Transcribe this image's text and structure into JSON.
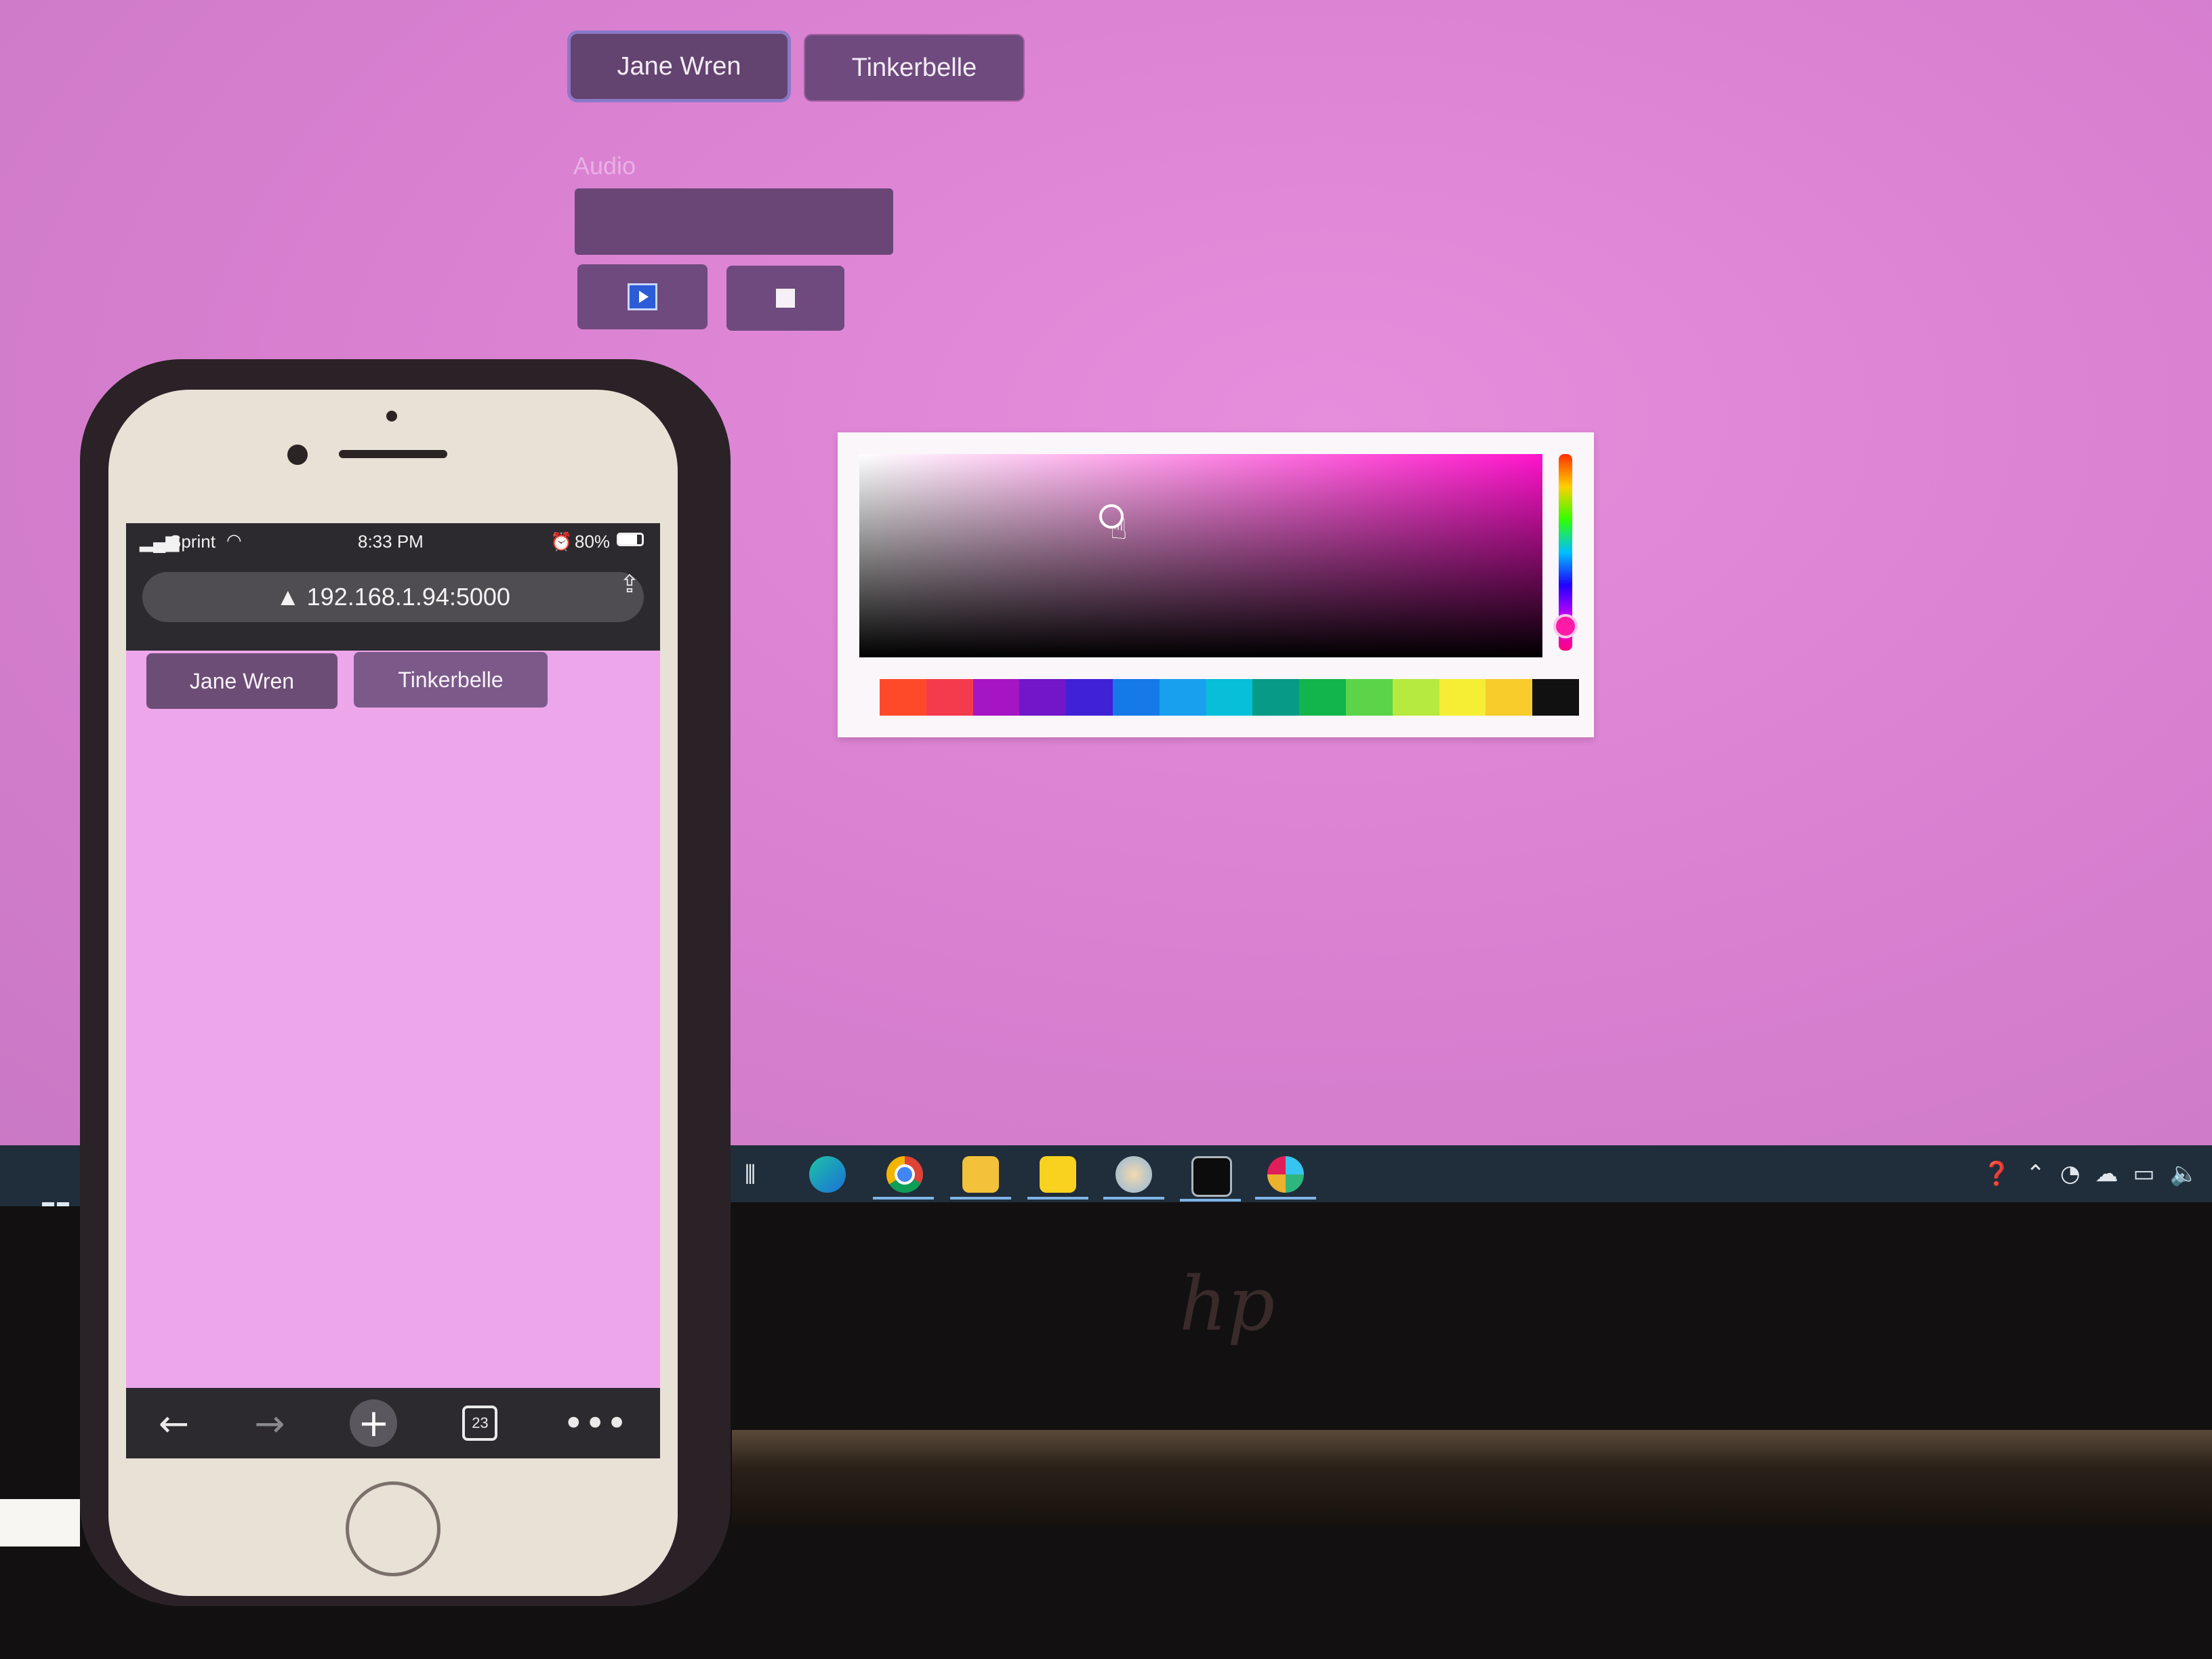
{
  "desktop": {
    "users": [
      {
        "label": "Jane Wren"
      },
      {
        "label": "Tinkerbelle"
      }
    ],
    "audio": {
      "label": "Audio",
      "value": ""
    },
    "media": {
      "play_icon": "play-icon",
      "stop_icon": "stop-icon"
    },
    "color_picker": {
      "hue_color": "#ff14cc",
      "swatches": [
        "#ff4a2a",
        "#f33b4d",
        "#a615c4",
        "#7116c9",
        "#4021d6",
        "#1579e8",
        "#18a0ee",
        "#07bfd8",
        "#069a87",
        "#12b54b",
        "#5bd449",
        "#b6ea3e",
        "#f5ee34",
        "#f8cc2a",
        "#111111"
      ]
    },
    "taskbar_icons": [
      "task-view-icon",
      "edge-icon",
      "chrome-icon",
      "file-explorer-icon",
      "sticky-notes-icon",
      "paint-icon",
      "terminal-icon",
      "slack-icon"
    ],
    "tray_icons": [
      "help-icon",
      "chevron-up-icon",
      "wifi-icon",
      "cloud-icon",
      "battery-icon",
      "speaker-icon"
    ]
  },
  "phone": {
    "carrier": "Sprint",
    "time": "8:33 PM",
    "battery": "80%",
    "url": "▲ 192.168.1.94:5000",
    "users": [
      {
        "label": "Jane Wren"
      },
      {
        "label": "Tinkerbelle"
      }
    ],
    "tab_count": "23"
  }
}
